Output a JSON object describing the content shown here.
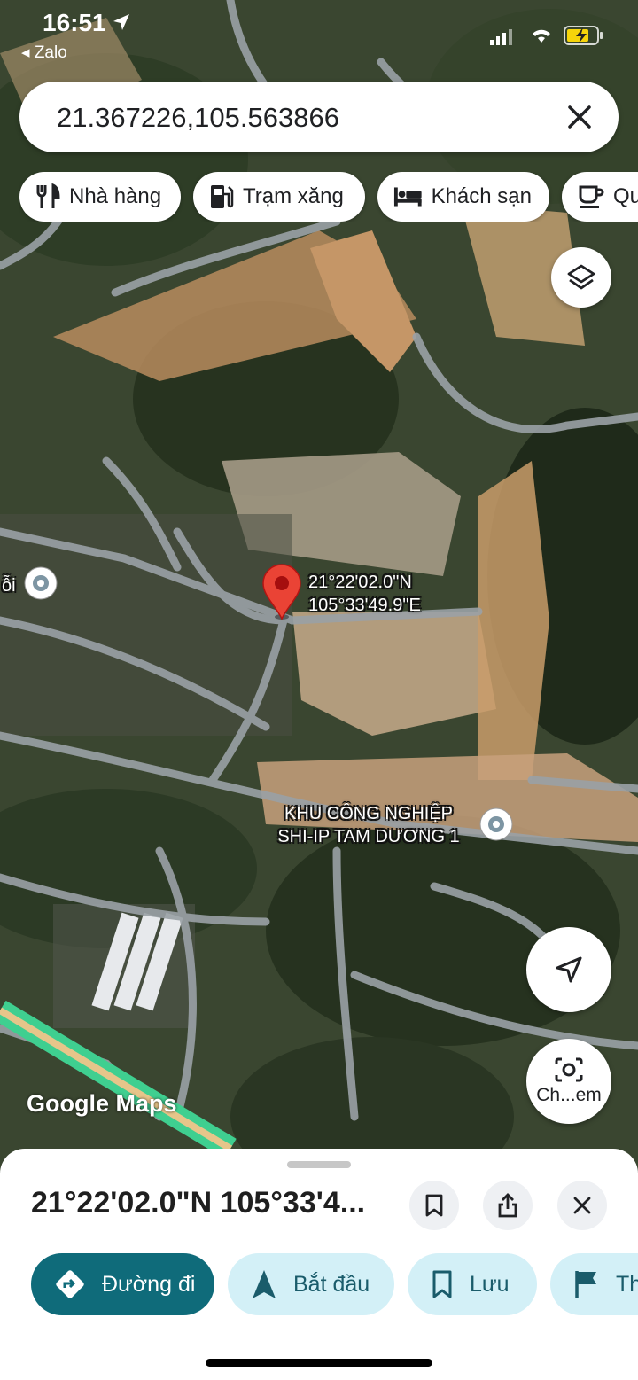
{
  "status_bar": {
    "time": "16:51",
    "back_app": "Zalo"
  },
  "search": {
    "value": "21.367226,105.563866"
  },
  "chips": [
    {
      "label": "Nhà hàng",
      "icon": "restaurant-icon"
    },
    {
      "label": "Trạm xăng",
      "icon": "gas-station-icon"
    },
    {
      "label": "Khách sạn",
      "icon": "hotel-icon"
    },
    {
      "label": "Qu",
      "icon": "coffee-icon"
    }
  ],
  "map": {
    "pin_label_line1": "21°22'02.0\"N",
    "pin_label_line2": "105°33'49.9\"E",
    "poi_label_line1": "KHU CÔNG NGHIỆP",
    "poi_label_line2": "SHI-IP TAM DƯƠNG 1",
    "left_poi_label": "ỗi",
    "google_logo": "Google Maps",
    "lens_button_label": "Ch...em"
  },
  "sheet": {
    "title": "21°22'02.0\"N 105°33'4...",
    "actions": [
      {
        "label": "Đường đi",
        "icon": "directions-icon"
      },
      {
        "label": "Bắt đầu",
        "icon": "navigation-icon"
      },
      {
        "label": "Lưu",
        "icon": "bookmark-icon"
      },
      {
        "label": "Th",
        "icon": "flag-icon"
      }
    ]
  },
  "colors": {
    "primary": "#0f6b7a",
    "tonal": "#d3f0f7",
    "pin": "#ea4335",
    "highway": "#5fe0a8"
  }
}
